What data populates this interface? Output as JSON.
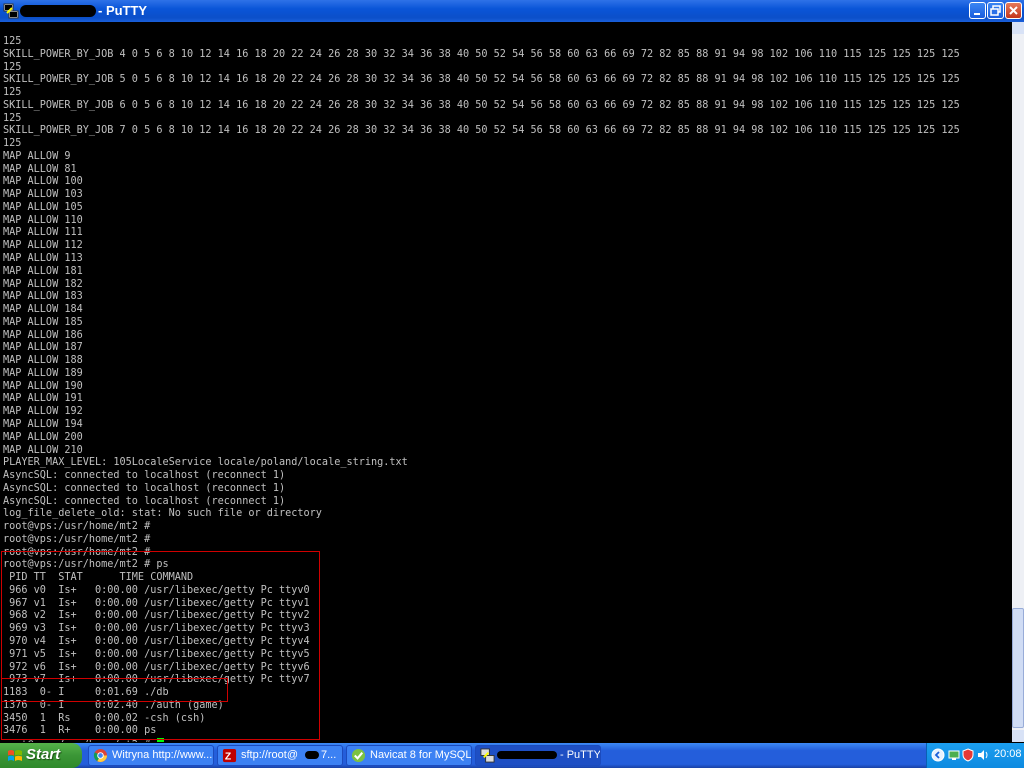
{
  "window": {
    "title": "- PuTTY"
  },
  "terminal": {
    "lines": [
      "125",
      "SKILL_POWER_BY_JOB 4 0 5 6 8 10 12 14 16 18 20 22 24 26 28 30 32 34 36 38 40 50 52 54 56 58 60 63 66 69 72 82 85 88 91 94 98 102 106 110 115 125 125 125 125",
      "125",
      "SKILL_POWER_BY_JOB 5 0 5 6 8 10 12 14 16 18 20 22 24 26 28 30 32 34 36 38 40 50 52 54 56 58 60 63 66 69 72 82 85 88 91 94 98 102 106 110 115 125 125 125 125",
      "125",
      "SKILL_POWER_BY_JOB 6 0 5 6 8 10 12 14 16 18 20 22 24 26 28 30 32 34 36 38 40 50 52 54 56 58 60 63 66 69 72 82 85 88 91 94 98 102 106 110 115 125 125 125 125",
      "125",
      "SKILL_POWER_BY_JOB 7 0 5 6 8 10 12 14 16 18 20 22 24 26 28 30 32 34 36 38 40 50 52 54 56 58 60 63 66 69 72 82 85 88 91 94 98 102 106 110 115 125 125 125 125",
      "125",
      "MAP ALLOW 9",
      "MAP ALLOW 81",
      "MAP ALLOW 100",
      "MAP ALLOW 103",
      "MAP ALLOW 105",
      "MAP ALLOW 110",
      "MAP ALLOW 111",
      "MAP ALLOW 112",
      "MAP ALLOW 113",
      "MAP ALLOW 181",
      "MAP ALLOW 182",
      "MAP ALLOW 183",
      "MAP ALLOW 184",
      "MAP ALLOW 185",
      "MAP ALLOW 186",
      "MAP ALLOW 187",
      "MAP ALLOW 188",
      "MAP ALLOW 189",
      "MAP ALLOW 190",
      "MAP ALLOW 191",
      "MAP ALLOW 192",
      "MAP ALLOW 194",
      "MAP ALLOW 200",
      "MAP ALLOW 210",
      "PLAYER_MAX_LEVEL: 105LocaleService locale/poland/locale_string.txt",
      "AsyncSQL: connected to localhost (reconnect 1)",
      "AsyncSQL: connected to localhost (reconnect 1)",
      "AsyncSQL: connected to localhost (reconnect 1)",
      "log_file_delete_old: stat: No such file or directory",
      "root@vps:/usr/home/mt2 #",
      "root@vps:/usr/home/mt2 #",
      "root@vps:/usr/home/mt2 #",
      "root@vps:/usr/home/mt2 # ps",
      " PID TT  STAT      TIME COMMAND",
      " 966 v0  Is+   0:00.00 /usr/libexec/getty Pc ttyv0",
      " 967 v1  Is+   0:00.00 /usr/libexec/getty Pc ttyv1",
      " 968 v2  Is+   0:00.00 /usr/libexec/getty Pc ttyv2",
      " 969 v3  Is+   0:00.00 /usr/libexec/getty Pc ttyv3",
      " 970 v4  Is+   0:00.00 /usr/libexec/getty Pc ttyv4",
      " 971 v5  Is+   0:00.00 /usr/libexec/getty Pc ttyv5",
      " 972 v6  Is+   0:00.00 /usr/libexec/getty Pc ttyv6",
      " 973 v7  Is+   0:00.00 /usr/libexec/getty Pc ttyv7",
      "1183  0- I     0:01.69 ./db",
      "1376  0- I     0:02.40 ./auth (game)",
      "3450  1  Rs    0:00.02 -csh (csh)",
      "3476  1  R+    0:00.00 ps"
    ],
    "prompt": "root@vps:/usr/home/mt2 # ",
    "cursor_color": "#00ff00",
    "highlight_color": "#d00000"
  },
  "taskbar": {
    "start_label": "Start",
    "tasks": [
      {
        "label": "Witryna http://www....",
        "icon": "chrome-icon"
      },
      {
        "label": "sftp://root@",
        "suffix": "7...",
        "icon": "filezilla-icon"
      },
      {
        "label": "Navicat 8 for MySQL",
        "icon": "navicat-icon"
      },
      {
        "label": "- PuTTY",
        "icon": "putty-icon"
      }
    ],
    "clock": "20:08"
  }
}
